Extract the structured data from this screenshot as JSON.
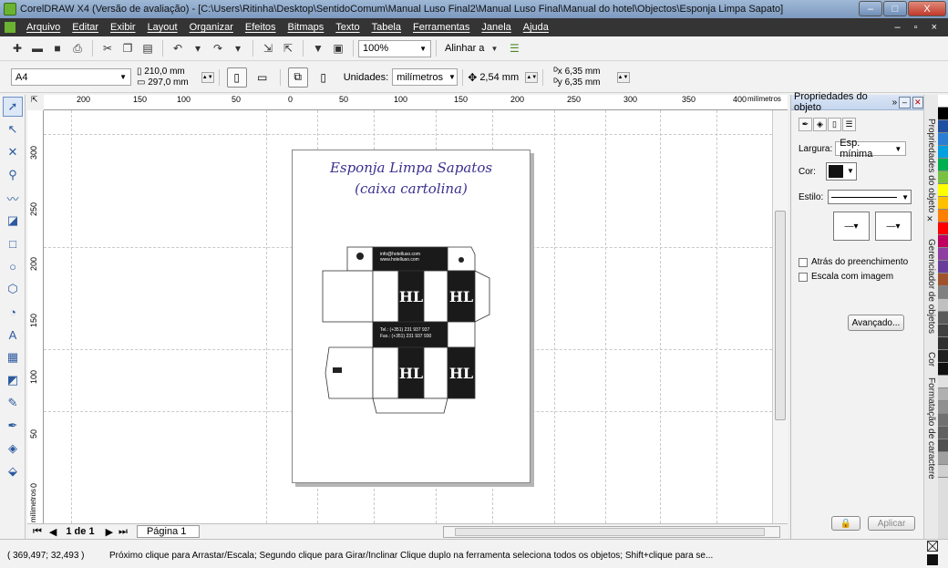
{
  "window": {
    "title": "CorelDRAW X4 (Versão de avaliação) - [C:\\Users\\Ritinha\\Desktop\\SentidoComum\\Manual Luso Final2\\Manual Luso Final\\Manual do hotel\\Objectos\\Esponja Limpa Sapato]",
    "minimize": "–",
    "maximize": "□",
    "close": "X"
  },
  "menu": {
    "items": [
      "Arquivo",
      "Editar",
      "Exibir",
      "Layout",
      "Organizar",
      "Efeitos",
      "Bitmaps",
      "Texto",
      "Tabela",
      "Ferramentas",
      "Janela",
      "Ajuda"
    ],
    "right_controls": "– ▫ ×"
  },
  "toolbar": {
    "zoom": "100%",
    "align_label": "Alinhar a"
  },
  "property_bar": {
    "page_size": "A4",
    "width": "210,0 mm",
    "height": "297,0 mm",
    "units_label": "Unidades:",
    "units_value": "milímetros",
    "nudge": "2,54 mm",
    "dup_x": "6,35 mm",
    "dup_y": "6,35 mm"
  },
  "rulers": {
    "h_ticks": [
      "200",
      "150",
      "100",
      "50",
      "0",
      "50",
      "100",
      "150",
      "200",
      "250",
      "300",
      "350",
      "400"
    ],
    "h_unit": "milímetros",
    "v_ticks": [
      "300",
      "250",
      "200",
      "150",
      "100",
      "50",
      "0"
    ],
    "v_unit": "milímetros"
  },
  "document": {
    "title_line1": "Esponja Limpa Sapatos",
    "title_line2": "(caixa cartolina)",
    "box_email": "info@hotelluso.com",
    "box_web": "www.hotelluso.com",
    "box_tel": "Tel.: (+351) 231 937 937",
    "box_fax": "Fax.: (+351) 231 937 930",
    "logo_text": "HL"
  },
  "page_nav": {
    "page_count": "1 de 1",
    "page_tab": "Página 1"
  },
  "status": {
    "coords": "( 369,497; 32,493 )",
    "message": "Próximo clique para Arrastar/Escala; Segundo clique para Girar/Inclinar Clique duplo na ferramenta seleciona todos os objetos; Shift+clique para se..."
  },
  "docker": {
    "title": "Propriedades do objeto",
    "width_label": "Largura:",
    "width_value": "Esp. mínima",
    "color_label": "Cor:",
    "style_label": "Estilo:",
    "behind_fill": "Atrás do preenchimento",
    "scale_image": "Escala com imagem",
    "advanced_button": "Avançado...",
    "apply_button": "Aplicar"
  },
  "side_tabs": [
    "Propriedades do objeto",
    "Gerenciador de objetos",
    "Cor",
    "Formatação de caractere"
  ],
  "colors": {
    "canvas_title": "#3a2f8f",
    "palette": [
      "#ffffff",
      "#000000",
      "#1f4fa0",
      "#2a7fd4",
      "#00a0e0",
      "#00b050",
      "#7ac143",
      "#ffff00",
      "#ffc000",
      "#ff7f00",
      "#ff0000",
      "#c00060",
      "#8e3fa0",
      "#6a3d9a",
      "#a0522d",
      "#808080",
      "#c0c0c0",
      "#5a5a5a",
      "#404040",
      "#303030",
      "#202020",
      "#101010",
      "#e0e0e0",
      "#b0b0b0",
      "#909090",
      "#707070",
      "#606060",
      "#505050",
      "#a0a0a0",
      "#d0d0d0"
    ]
  }
}
